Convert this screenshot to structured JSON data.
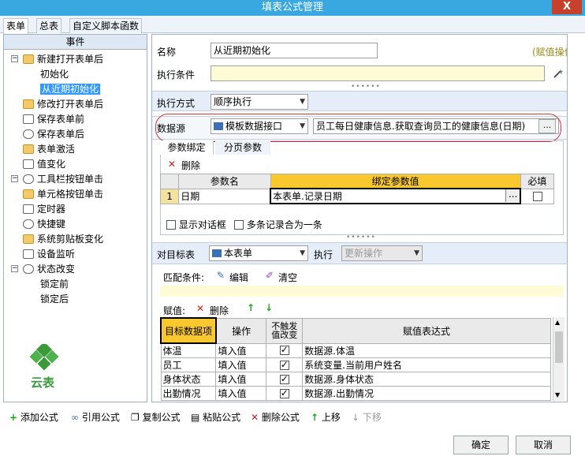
{
  "window": {
    "title": "填表公式管理",
    "close_glyph": "X"
  },
  "tabs": [
    "表单",
    "总表",
    "自定义脚本函数"
  ],
  "events": {
    "header": "事件",
    "items": [
      {
        "label": "新建打开表单后",
        "level": 0
      },
      {
        "label": "初始化",
        "level": 1
      },
      {
        "label": "从近期初始化",
        "level": 1,
        "selected": true
      },
      {
        "label": "修改打开表单后",
        "level": 0
      },
      {
        "label": "保存表单前",
        "level": 0
      },
      {
        "label": "保存表单后",
        "level": 0
      },
      {
        "label": "表单激活",
        "level": 0
      },
      {
        "label": "值变化",
        "level": 0
      },
      {
        "label": "工具栏按钮单击",
        "level": 0
      },
      {
        "label": "单元格按钮单击",
        "level": 0
      },
      {
        "label": "定时器",
        "level": 0
      },
      {
        "label": "快捷键",
        "level": 0
      },
      {
        "label": "系统剪贴板变化",
        "level": 0
      },
      {
        "label": "设备监听",
        "level": 0
      },
      {
        "label": "状态改变",
        "level": 0
      },
      {
        "label": "锁定前",
        "level": 1
      },
      {
        "label": "锁定后",
        "level": 1
      }
    ]
  },
  "logo_text": "云表",
  "form": {
    "name_label": "名称",
    "name_value": "从近期初始化",
    "assign_op": "(赋值操作)",
    "cond_label": "执行条件",
    "cond_value": "",
    "mode_label": "执行方式",
    "mode_value": "顺序执行",
    "source_label": "数据源",
    "source_type": "模板数据接口",
    "source_value": "员工每日健康信息.获取查询员工的健康信息(日期)",
    "source_btn": "...",
    "param_tabs": [
      "参数绑定",
      "分页参数"
    ],
    "delete_label": "删除",
    "param_headers": [
      "参数名",
      "绑定参数值",
      "必填"
    ],
    "params": [
      {
        "idx": "1",
        "name": "日期",
        "value": "本表单.记录日期",
        "btn": "...",
        "required": false
      }
    ],
    "show_dialog": "显示对话框",
    "merge_records": "多条记录合为一条",
    "target_label": "对目标表",
    "target_value": "本表单",
    "exec_label": "执行",
    "exec_value": "更新操作",
    "match_label": "匹配条件:",
    "edit_label": "编辑",
    "clear_label": "清空",
    "assign_label": "赋值:",
    "assign_delete": "删除",
    "assign_headers": [
      "目标数据项",
      "操作",
      "不触发值改变",
      "赋值表达式"
    ],
    "assigns": [
      {
        "target": "体温",
        "op": "填入值",
        "nochange": true,
        "expr": "数据源.体温"
      },
      {
        "target": "员工",
        "op": "填入值",
        "nochange": true,
        "expr": "系统变量.当前用户姓名"
      },
      {
        "target": "身体状态",
        "op": "填入值",
        "nochange": true,
        "expr": "数据源.身体状态"
      },
      {
        "target": "出勤情况",
        "op": "填入值",
        "nochange": true,
        "expr": "数据源.出勤情况"
      }
    ]
  },
  "toolbar": {
    "add": "添加公式",
    "ref": "引用公式",
    "copy": "复制公式",
    "paste": "粘贴公式",
    "del": "删除公式",
    "up": "上移",
    "down": "下移"
  },
  "buttons": {
    "ok": "确定",
    "cancel": "取消"
  }
}
